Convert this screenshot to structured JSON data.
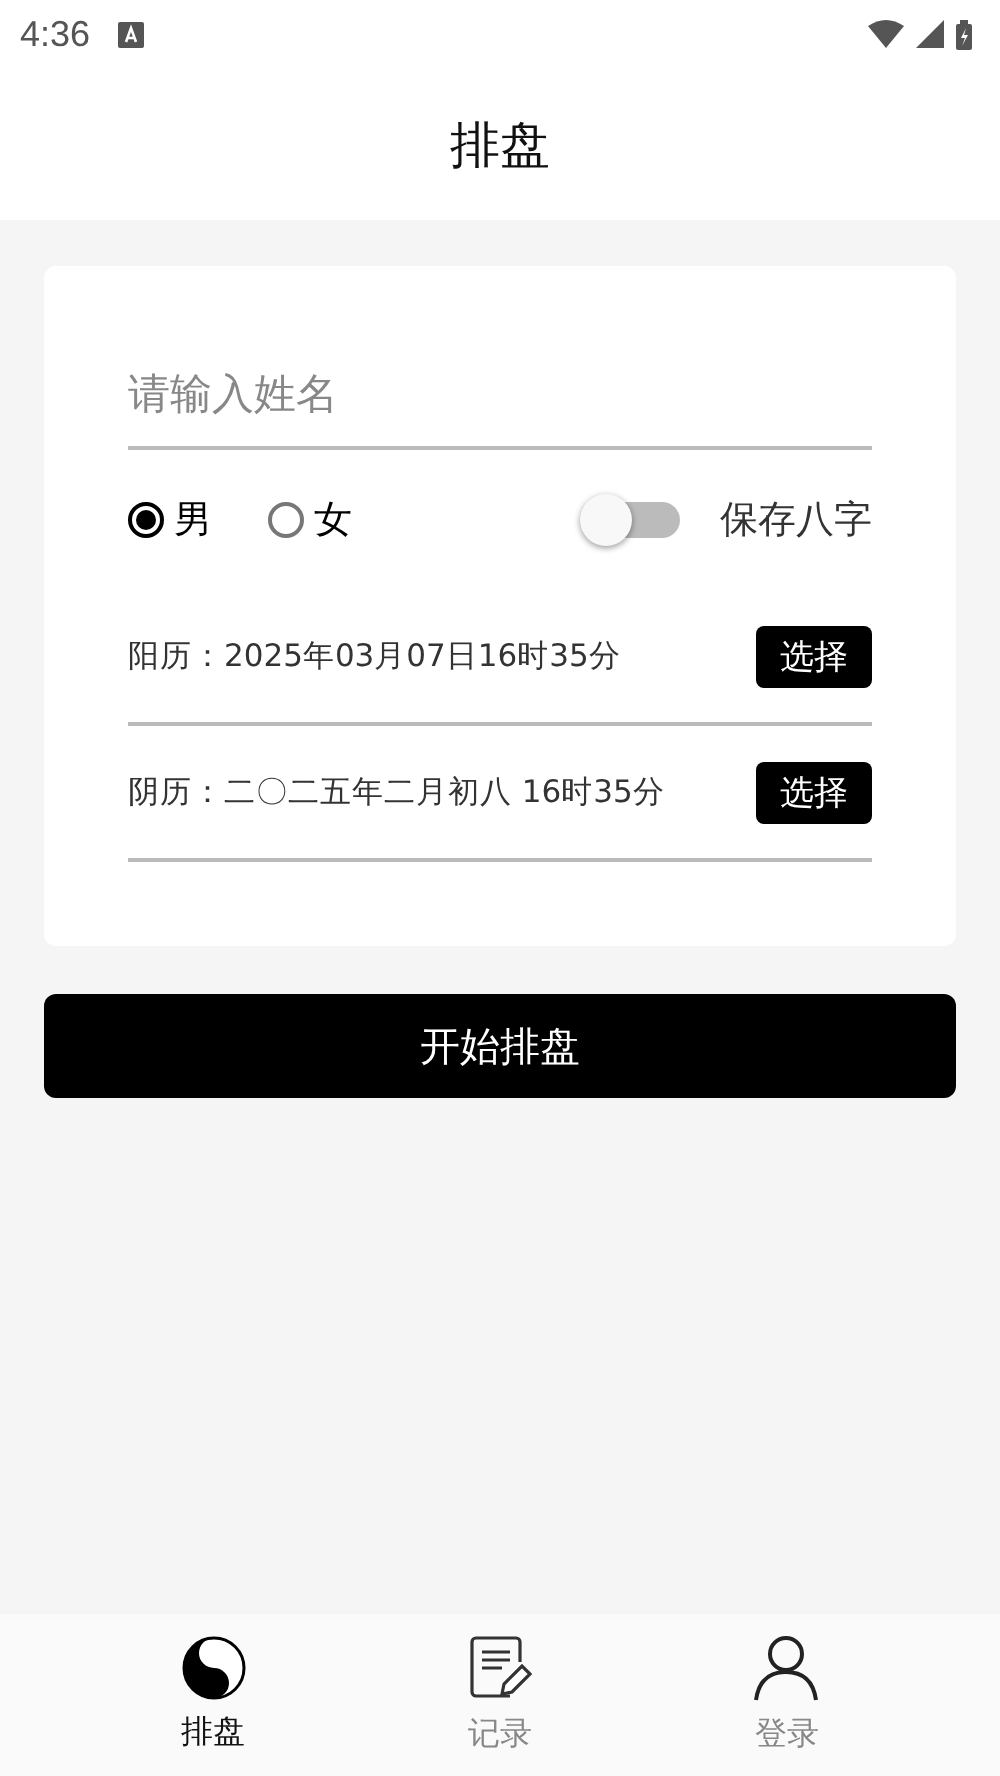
{
  "status_bar": {
    "time": "4:36"
  },
  "header": {
    "title": "排盘"
  },
  "form": {
    "name_field": {
      "placeholder": "请输入姓名"
    },
    "genders": [
      {
        "label": "男",
        "selected": true
      },
      {
        "label": "女",
        "selected": false
      }
    ],
    "save_switch": {
      "label": "保存八字",
      "on": false
    },
    "dates": [
      {
        "label": "阳历：2025年03月07日16时35分",
        "button": "选择"
      },
      {
        "label": "阴历：二〇二五年二月初八 16时35分",
        "button": "选择"
      }
    ]
  },
  "start_button": "开始排盘",
  "tabs": [
    {
      "label": "排盘",
      "kind": "yinyang",
      "selected": true
    },
    {
      "label": "记录",
      "kind": "notes",
      "selected": false
    },
    {
      "label": "登录",
      "kind": "person",
      "selected": false
    }
  ]
}
